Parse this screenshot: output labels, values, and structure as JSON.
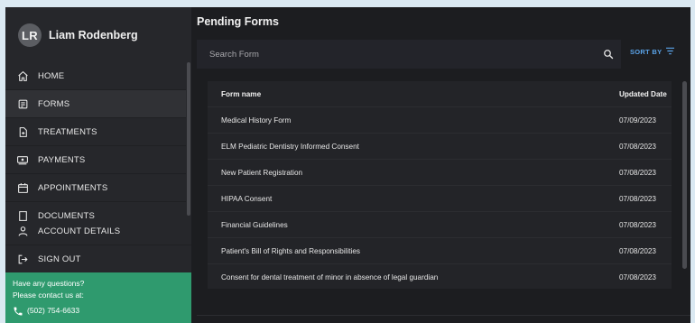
{
  "user": {
    "initials": "LR",
    "name": "Liam Rodenberg"
  },
  "sidebar": {
    "items": [
      {
        "label": "HOME",
        "icon": "home-icon"
      },
      {
        "label": "FORMS",
        "icon": "form-icon"
      },
      {
        "label": "TREATMENTS",
        "icon": "treatment-icon"
      },
      {
        "label": "PAYMENTS",
        "icon": "payment-icon"
      },
      {
        "label": "APPOINTMENTS",
        "icon": "calendar-icon"
      },
      {
        "label": "DOCUMENTS",
        "icon": "document-icon"
      }
    ],
    "bottom_items": [
      {
        "label": "ACCOUNT DETAILS",
        "icon": "person-icon"
      },
      {
        "label": "SIGN OUT",
        "icon": "sign-out-icon"
      }
    ],
    "contact": {
      "line1": "Have any questions?",
      "line2": "Please contact us at:",
      "phone": "(502) 754-6633"
    }
  },
  "main": {
    "title": "Pending Forms",
    "search": {
      "placeholder": "Search Form",
      "value": ""
    },
    "sort_label": "SORT BY",
    "table": {
      "columns": [
        "Form name",
        "Updated Date"
      ],
      "rows": [
        {
          "name": "Medical History Form",
          "date": "07/09/2023"
        },
        {
          "name": "ELM Pediatric Dentistry Informed Consent",
          "date": "07/08/2023"
        },
        {
          "name": "New Patient Registration",
          "date": "07/08/2023"
        },
        {
          "name": "HIPAA Consent",
          "date": "07/08/2023"
        },
        {
          "name": "Financial Guidelines",
          "date": "07/08/2023"
        },
        {
          "name": "Patient's Bill of Rights and Responsibilities",
          "date": "07/08/2023"
        },
        {
          "name": "Consent for dental treatment of minor in absence of legal guardian",
          "date": "07/08/2023"
        }
      ]
    }
  },
  "colors": {
    "accent": "#5aa4ea",
    "contact_bg": "#2f9a6e",
    "sidebar_bg": "#26272b",
    "main_bg": "#1c1d20"
  }
}
